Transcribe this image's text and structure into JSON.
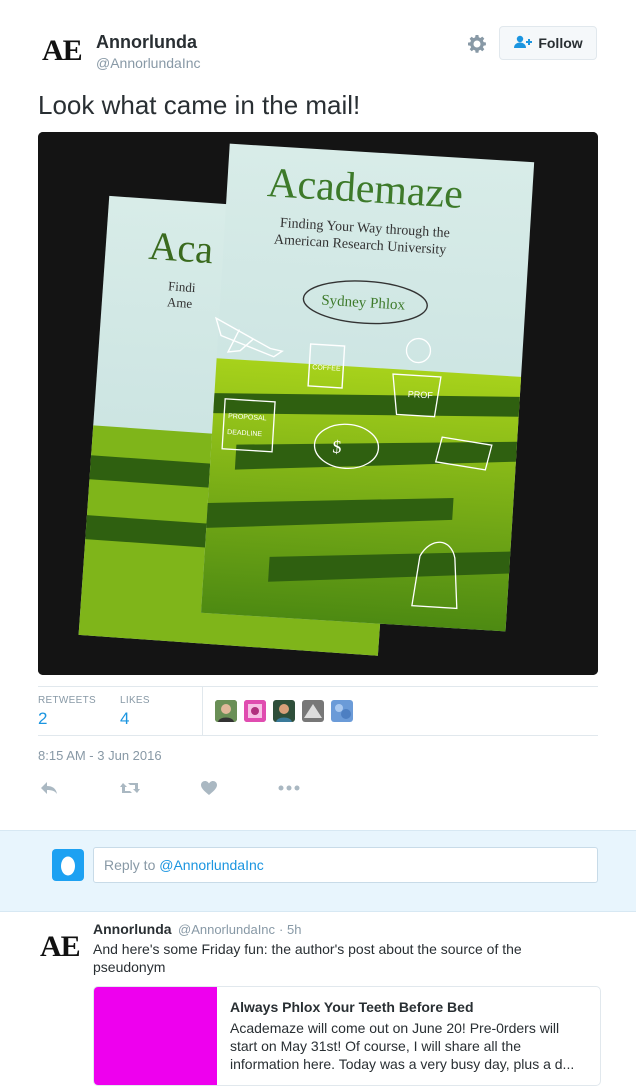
{
  "tweet": {
    "author": {
      "avatar_text": "AE",
      "name": "Annorlunda",
      "handle": "@AnnorlundaInc"
    },
    "follow_label": "Follow",
    "text": "Look what came in the mail!",
    "photo": {
      "book_title": "Academaze",
      "book_subtitle_1": "Finding Your Way through the",
      "book_subtitle_2": "American Research University",
      "book_author": "Sydney Phlox",
      "back_title": "Aca",
      "back_sub_1": "Findi",
      "back_sub_2": "Ame",
      "labels": {
        "coffee": "COFFEE",
        "prof": "PROF",
        "proposal": "PROPOSAL",
        "deadline": "DEADLINE",
        "dollar": "$"
      }
    },
    "stats": {
      "retweets_label": "RETWEETS",
      "retweets": "2",
      "likes_label": "LIKES",
      "likes": "4"
    },
    "timestamp": "8:15 AM - 3 Jun 2016",
    "colors": {
      "accent": "#1b95e0",
      "muted": "#8899a6",
      "text": "#292f33",
      "reply_bg": "#e8f5fd"
    }
  },
  "reply": {
    "prefix": "Reply to ",
    "mention": "@AnnorlundaInc"
  },
  "reply_tweet": {
    "avatar_text": "AE",
    "name": "Annorlunda",
    "handle": "@AnnorlundaInc",
    "separator": "·",
    "time": "5h",
    "text": "And here's some Friday fun: the author's post about the source of the pseudonym",
    "card": {
      "title": "Always Phlox Your Teeth Before Bed",
      "description": "Academaze will come out on June 20! Pre-0rders will start on May 31st! Of course, I will share all the information here. Today was a very busy day, plus a d...",
      "image_color": "#ee00ee"
    }
  }
}
